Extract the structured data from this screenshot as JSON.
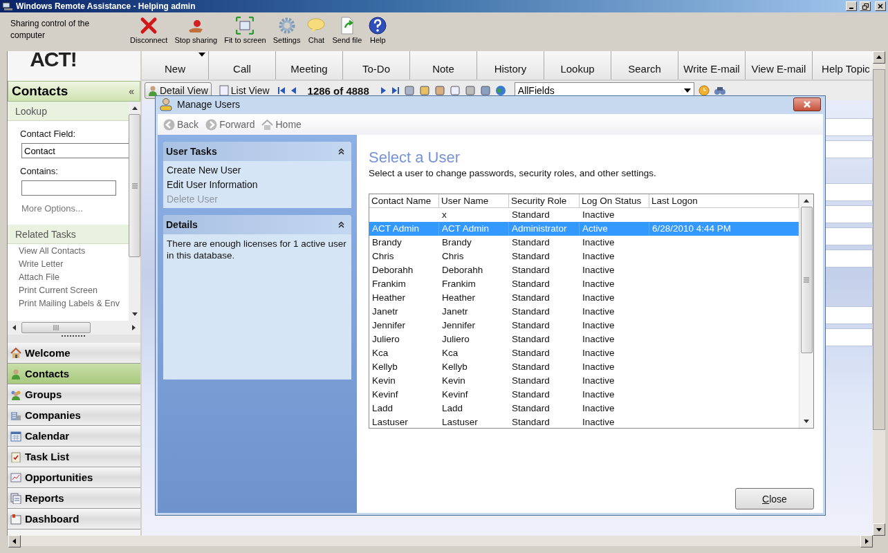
{
  "window": {
    "title": "Windows Remote Assistance - Helping admin"
  },
  "assistance_bar": {
    "status": "Sharing control of the computer",
    "buttons": [
      {
        "label": "Disconnect",
        "kind": "disconnect"
      },
      {
        "label": "Stop sharing",
        "kind": "stop"
      },
      {
        "label": "Fit to screen",
        "kind": "fit"
      },
      {
        "label": "Settings",
        "kind": "settings"
      },
      {
        "label": "Chat",
        "kind": "chat"
      },
      {
        "label": "Send file",
        "kind": "send"
      },
      {
        "label": "Help",
        "kind": "help"
      }
    ]
  },
  "app": {
    "logo": "ACT!",
    "toolbar": [
      {
        "label": "New",
        "dropdown": true
      },
      {
        "label": "Call",
        "dropdown": false
      },
      {
        "label": "Meeting",
        "dropdown": false
      },
      {
        "label": "To-Do",
        "dropdown": false
      },
      {
        "label": "Note",
        "dropdown": false
      },
      {
        "label": "History",
        "dropdown": false
      },
      {
        "label": "Lookup",
        "dropdown": false
      },
      {
        "label": "Search",
        "dropdown": false
      },
      {
        "label": "Write E-mail",
        "dropdown": false
      },
      {
        "label": "View E-mail",
        "dropdown": false
      },
      {
        "label": "Help Topic",
        "dropdown": false
      }
    ],
    "view_tabs": [
      {
        "label": "Detail View",
        "selected": true
      },
      {
        "label": "List View",
        "selected": false
      }
    ],
    "record_counter": "1286 of 4888",
    "lookup_field": "AllFields",
    "sidebar": {
      "title": "Contacts",
      "collapse": "«",
      "lookup": {
        "header": "Lookup",
        "field_label": "Contact Field:",
        "field_value": "Contact",
        "contains_label": "Contains:",
        "more_options": "More Options..."
      },
      "related_header": "Related Tasks",
      "related_tasks": [
        "View All Contacts",
        "Write Letter",
        "Attach File",
        "Print Current Screen",
        "Print Mailing Labels & Env"
      ],
      "nav": [
        {
          "label": "Welcome",
          "kind": "home",
          "selected": false
        },
        {
          "label": "Contacts",
          "kind": "contacts",
          "selected": true
        },
        {
          "label": "Groups",
          "kind": "groups",
          "selected": false
        },
        {
          "label": "Companies",
          "kind": "companies",
          "selected": false
        },
        {
          "label": "Calendar",
          "kind": "calendar",
          "selected": false
        },
        {
          "label": "Task List",
          "kind": "tasks",
          "selected": false
        },
        {
          "label": "Opportunities",
          "kind": "opportunities",
          "selected": false
        },
        {
          "label": "Reports",
          "kind": "reports",
          "selected": false
        },
        {
          "label": "Dashboard",
          "kind": "dashboard",
          "selected": false
        }
      ]
    }
  },
  "dialog": {
    "title": "Manage Users",
    "nav": [
      {
        "label": "Back",
        "kind": "back"
      },
      {
        "label": "Forward",
        "kind": "forward"
      },
      {
        "label": "Home",
        "kind": "home"
      }
    ],
    "panels": [
      {
        "title": "User Tasks",
        "items": [
          {
            "label": "Create New User",
            "disabled": false
          },
          {
            "label": "Edit User Information",
            "disabled": false
          },
          {
            "label": "Delete User",
            "disabled": true
          }
        ]
      },
      {
        "title": "Details",
        "text": "There are enough licenses for 1 active user in this database."
      }
    ],
    "heading": "Select a User",
    "subtitle": "Select a user to change passwords, security roles, and other settings.",
    "table": {
      "columns": [
        "Contact Name",
        "User Name",
        "Security Role",
        "Log On Status",
        "Last Logon"
      ],
      "rows": [
        {
          "cells": [
            "",
            "x",
            "Standard",
            "Inactive",
            ""
          ],
          "selected": false
        },
        {
          "cells": [
            "ACT Admin",
            "ACT Admin",
            "Administrator",
            "Active",
            "6/28/2010 4:44 PM"
          ],
          "selected": true
        },
        {
          "cells": [
            "Brandy",
            "Brandy",
            "Standard",
            "Inactive",
            ""
          ],
          "selected": false
        },
        {
          "cells": [
            "Chris",
            "Chris",
            "Standard",
            "Inactive",
            ""
          ],
          "selected": false
        },
        {
          "cells": [
            "Deborahh",
            "Deborahh",
            "Standard",
            "Inactive",
            ""
          ],
          "selected": false
        },
        {
          "cells": [
            "Frankim",
            "Frankim",
            "Standard",
            "Inactive",
            ""
          ],
          "selected": false
        },
        {
          "cells": [
            "Heather",
            "Heather",
            "Standard",
            "Inactive",
            ""
          ],
          "selected": false
        },
        {
          "cells": [
            "Janetr",
            "Janetr",
            "Standard",
            "Inactive",
            ""
          ],
          "selected": false
        },
        {
          "cells": [
            "Jennifer",
            "Jennifer",
            "Standard",
            "Inactive",
            ""
          ],
          "selected": false
        },
        {
          "cells": [
            "Juliero",
            "Juliero",
            "Standard",
            "Inactive",
            ""
          ],
          "selected": false
        },
        {
          "cells": [
            "Kca",
            "Kca",
            "Standard",
            "Inactive",
            ""
          ],
          "selected": false
        },
        {
          "cells": [
            "Kellyb",
            "Kellyb",
            "Standard",
            "Inactive",
            ""
          ],
          "selected": false
        },
        {
          "cells": [
            "Kevin",
            "Kevin",
            "Standard",
            "Inactive",
            ""
          ],
          "selected": false
        },
        {
          "cells": [
            "Kevinf",
            "Kevinf",
            "Standard",
            "Inactive",
            ""
          ],
          "selected": false
        },
        {
          "cells": [
            "Ladd",
            "Ladd",
            "Standard",
            "Inactive",
            ""
          ],
          "selected": false
        },
        {
          "cells": [
            "Lastuser",
            "Lastuser",
            "Standard",
            "Inactive",
            ""
          ],
          "selected": false
        }
      ]
    },
    "close_button": "Close"
  }
}
